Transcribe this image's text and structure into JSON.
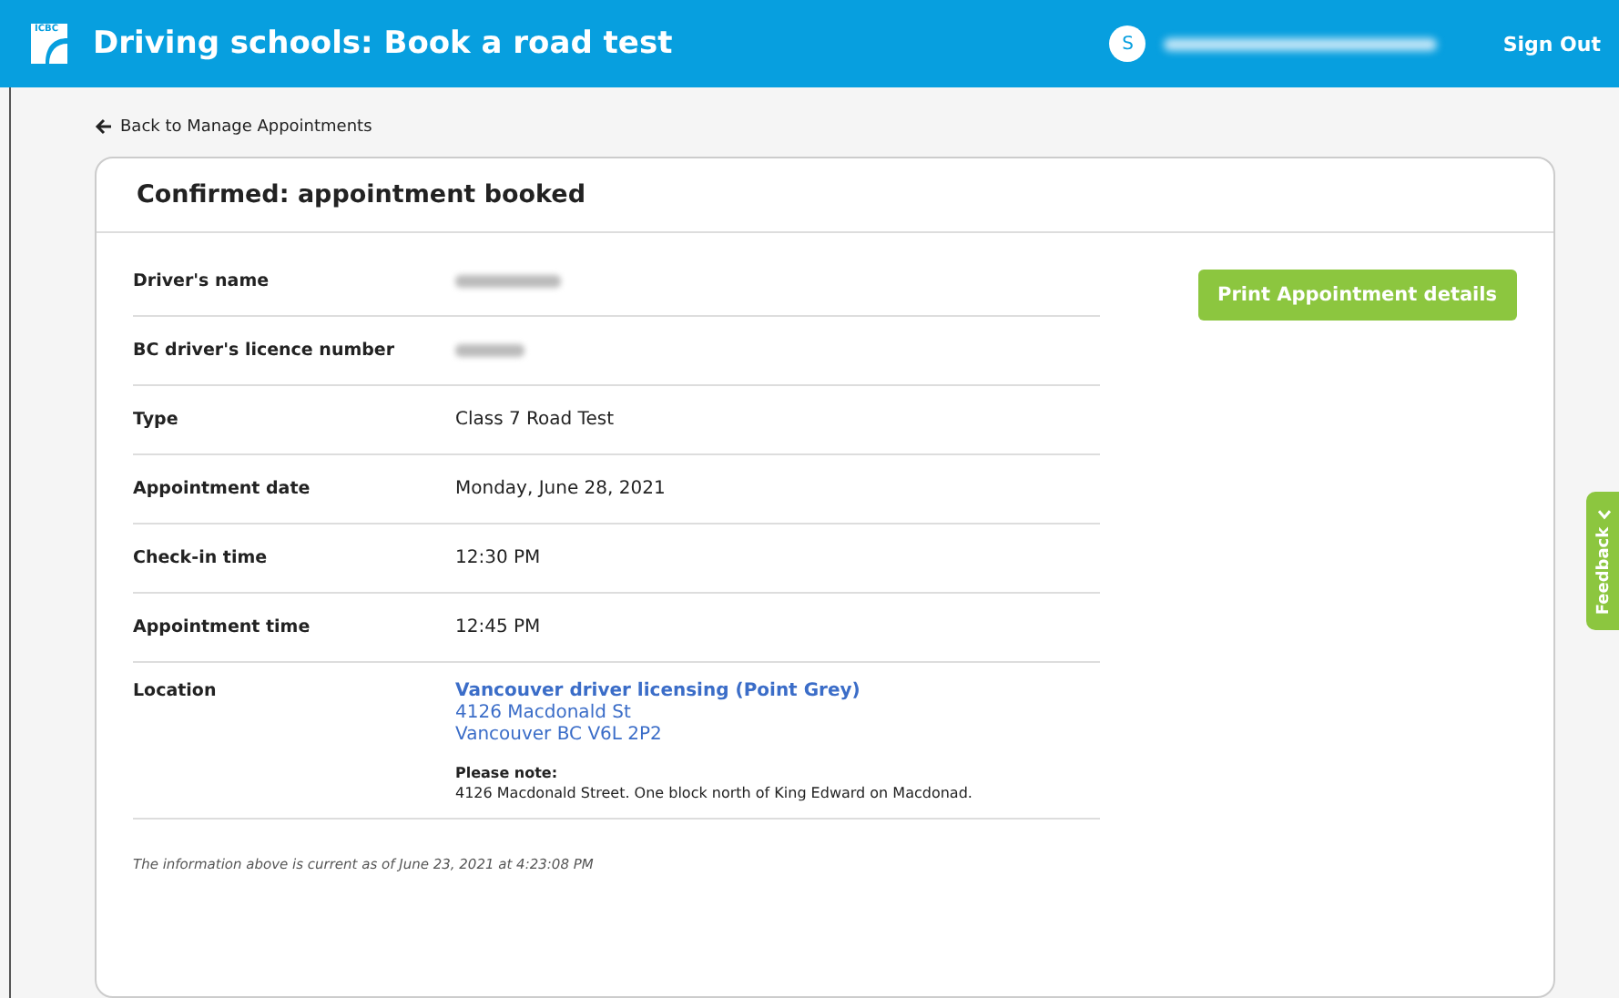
{
  "header": {
    "logo": "ICBC",
    "title": "Driving schools: Book a road test",
    "avatar": "S",
    "sign_out": "Sign Out"
  },
  "back_link": "Back to Manage Appointments",
  "card": {
    "title": "Confirmed: appointment booked",
    "rows": [
      {
        "kind": "blurred",
        "label": "Driver's name"
      },
      {
        "kind": "blurred",
        "label": "BC driver's licence number"
      },
      {
        "kind": "text",
        "label": "Type",
        "value": "Class 7 Road Test"
      },
      {
        "kind": "text",
        "label": "Appointment date",
        "value": "Monday, June 28, 2021"
      },
      {
        "kind": "text",
        "label": "Check-in time",
        "value": "12:30 PM"
      },
      {
        "kind": "text",
        "label": "Appointment time",
        "value": "12:45 PM"
      },
      {
        "kind": "location",
        "label": "Location",
        "name": "Vancouver driver licensing (Point Grey)",
        "address": [
          "4126 Macdonald St",
          "Vancouver BC V6L 2P2"
        ],
        "note_title": "Please note:",
        "note": "4126 Macdonald Street. One block north of King Edward on Macdonad."
      }
    ],
    "footnote": "The information above is current as of June 23, 2021 at 4:23:08 PM",
    "print_button": "Print Appointment details"
  },
  "feedback_tab": "Feedback"
}
